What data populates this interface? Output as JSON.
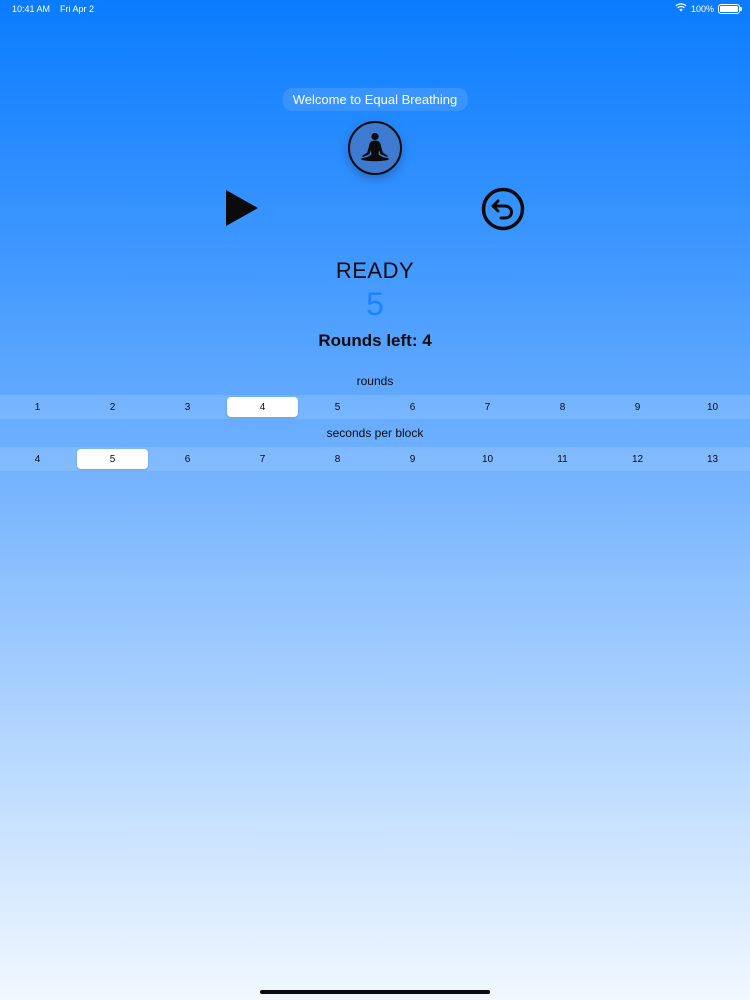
{
  "status_bar": {
    "time": "10:41 AM",
    "date": "Fri Apr 2",
    "battery_percent": "100%",
    "battery_level": 1.0,
    "wifi_icon": "wifi-icon"
  },
  "header": {
    "title": "Welcome to Equal Breathing",
    "logo_icon": "meditation-icon"
  },
  "controls": {
    "play_icon": "play-icon",
    "reset_icon": "reset-arrow-icon"
  },
  "session": {
    "state": "READY",
    "count": "5",
    "rounds_left": "Rounds left: 4"
  },
  "rounds_picker": {
    "label": "rounds",
    "options": [
      "1",
      "2",
      "3",
      "4",
      "5",
      "6",
      "7",
      "8",
      "9",
      "10"
    ],
    "selected": "4"
  },
  "seconds_picker": {
    "label": "seconds per block",
    "options": [
      "4",
      "5",
      "6",
      "7",
      "8",
      "9",
      "10",
      "11",
      "12",
      "13"
    ],
    "selected": "5"
  },
  "colors": {
    "accent": "#1c82ff",
    "title_pill": "#3a94ff",
    "background_top": "#0a7cff",
    "background_bottom": "#f2f8ff"
  }
}
